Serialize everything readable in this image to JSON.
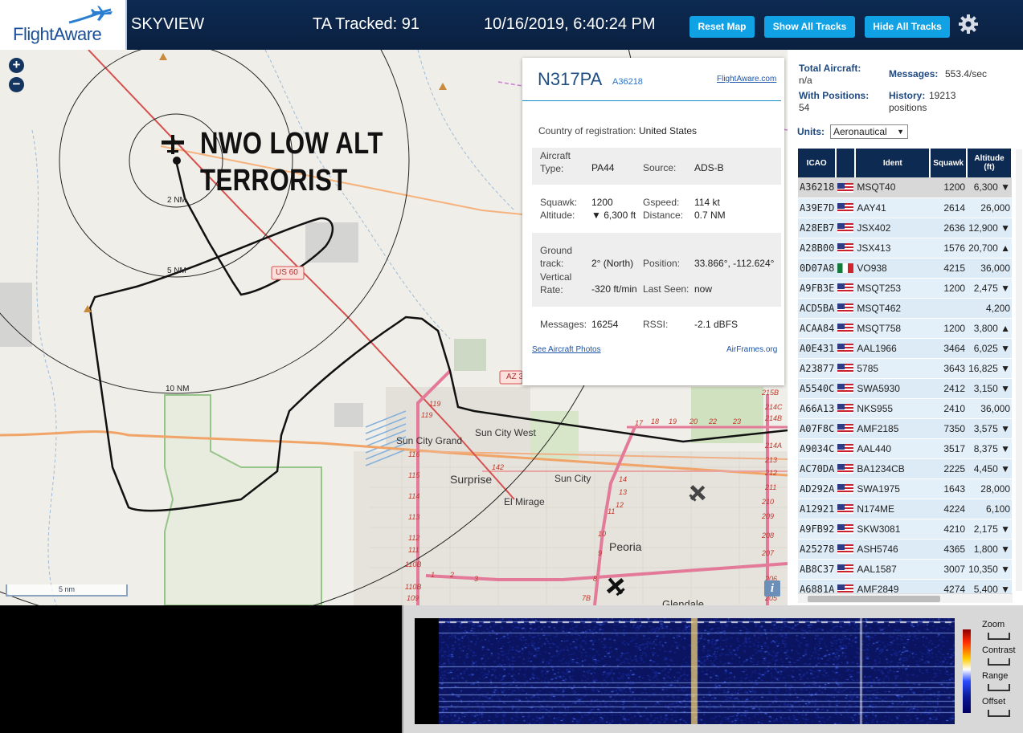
{
  "header": {
    "logo_text": "FlightAware",
    "app_title": "SKYVIEW",
    "tracked": "TA Tracked: 91",
    "datetime": "10/16/2019, 6:40:24 PM",
    "buttons": {
      "reset_map": "Reset Map",
      "show_all": "Show All Tracks",
      "hide_all": "Hide All Tracks"
    },
    "icons": {
      "settings": "gear-icon"
    },
    "colors": {
      "bar": "#0d2a52",
      "button": "#11a2e6"
    }
  },
  "map": {
    "zoom_in": "+",
    "zoom_out": "−",
    "overlay_text": [
      "NWO LOW ALT",
      "TERRORIST"
    ],
    "rings": [
      "2 NM",
      "5 NM",
      "10 NM"
    ],
    "places": [
      "Sun City Grand",
      "Sun City West",
      "Surprise",
      "Sun City",
      "El Mirage",
      "Peoria",
      "Glendale"
    ],
    "highways": [
      "US 60",
      "AZ 3"
    ],
    "exits_left": [
      "119",
      "119",
      "116",
      "115",
      "114",
      "113",
      "112",
      "111",
      "110B",
      "110B",
      "109"
    ],
    "exits_mid": [
      "142",
      "14",
      "13",
      "12",
      "11",
      "10",
      "9",
      "8",
      "7B"
    ],
    "exits_right": [
      "215B",
      "214C",
      "214B",
      "214A",
      "213",
      "212",
      "211",
      "210",
      "209",
      "208",
      "207",
      "206",
      "205"
    ],
    "exits_top": [
      "17",
      "18",
      "19",
      "20",
      "22",
      "23"
    ],
    "exits_bottom": [
      "1",
      "2",
      "3"
    ],
    "scale": "5 nm",
    "info": "i"
  },
  "popup": {
    "registration": "N317PA",
    "hex": "A36218",
    "link": "FlightAware.com",
    "country_label": "Country of registration:",
    "country": "United States",
    "aircraft_type_label": "Aircraft Type:",
    "aircraft_type": "PA44",
    "source_label": "Source:",
    "source": "ADS-B",
    "squawk_label": "Squawk:",
    "squawk": "1200",
    "gspeed_label": "Gspeed:",
    "gspeed": "114 kt",
    "altitude_label": "Altitude:",
    "altitude": "▼ 6,300 ft",
    "distance_label": "Distance:",
    "distance": "0.7 NM",
    "ground_track_label": "Ground track:",
    "ground_track": "2° (North)",
    "position_label": "Position:",
    "position": "33.866°, -112.624°",
    "vrate_label": "Vertical Rate:",
    "vrate": "-320 ft/min",
    "last_seen_label": "Last Seen:",
    "last_seen": "now",
    "messages_label": "Messages:",
    "messages": "16254",
    "rssi_label": "RSSI:",
    "rssi": "-2.1 dBFS",
    "photos": "See Aircraft Photos",
    "airframes": "AirFrames.org"
  },
  "sidebar": {
    "total_label": "Total Aircraft:",
    "total": "n/a",
    "messages_label": "Messages:",
    "messages": "553.4/sec",
    "with_pos_label": "With Positions:",
    "with_pos": "54",
    "history_label": "History:",
    "history": "19213 positions",
    "units_label": "Units:",
    "units": "Aeronautical",
    "columns": [
      "ICAO",
      "",
      "Ident",
      "Squawk",
      "Altitude (ft)"
    ],
    "rows": [
      {
        "icao": "A36218",
        "flag": "us",
        "ident": "MSQT40",
        "squawk": "1200",
        "alt": "6,300 ▼"
      },
      {
        "icao": "A39E7D",
        "flag": "us",
        "ident": "AAY41",
        "squawk": "2614",
        "alt": "26,000"
      },
      {
        "icao": "A28EB7",
        "flag": "us",
        "ident": "JSX402",
        "squawk": "2636",
        "alt": "12,900 ▼"
      },
      {
        "icao": "A28B00",
        "flag": "us",
        "ident": "JSX413",
        "squawk": "1576",
        "alt": "20,700 ▲"
      },
      {
        "icao": "0D07A8",
        "flag": "mx",
        "ident": "VO938",
        "squawk": "4215",
        "alt": "36,000"
      },
      {
        "icao": "A9FB3E",
        "flag": "us",
        "ident": "MSQT253",
        "squawk": "1200",
        "alt": "2,475 ▼"
      },
      {
        "icao": "ACD5BA",
        "flag": "us",
        "ident": "MSQT462",
        "squawk": "",
        "alt": "4,200"
      },
      {
        "icao": "ACAA84",
        "flag": "us",
        "ident": "MSQT758",
        "squawk": "1200",
        "alt": "3,800 ▲"
      },
      {
        "icao": "A0E431",
        "flag": "us",
        "ident": "AAL1966",
        "squawk": "3464",
        "alt": "6,025 ▼"
      },
      {
        "icao": "A23877",
        "flag": "us",
        "ident": "5785",
        "squawk": "3643",
        "alt": "16,825 ▼"
      },
      {
        "icao": "A5540C",
        "flag": "us",
        "ident": "SWA5930",
        "squawk": "2412",
        "alt": "3,150 ▼"
      },
      {
        "icao": "A66A13",
        "flag": "us",
        "ident": "NKS955",
        "squawk": "2410",
        "alt": "36,000"
      },
      {
        "icao": "A07F8C",
        "flag": "us",
        "ident": "AMF2185",
        "squawk": "7350",
        "alt": "3,575 ▼"
      },
      {
        "icao": "A9034C",
        "flag": "us",
        "ident": "AAL440",
        "squawk": "3517",
        "alt": "8,375 ▼"
      },
      {
        "icao": "AC70DA",
        "flag": "us",
        "ident": "BA1234CB",
        "squawk": "2225",
        "alt": "4,450 ▼"
      },
      {
        "icao": "AD292A",
        "flag": "us",
        "ident": "SWA1975",
        "squawk": "1643",
        "alt": "28,000"
      },
      {
        "icao": "A12921",
        "flag": "us",
        "ident": "N174ME",
        "squawk": "4224",
        "alt": "6,100"
      },
      {
        "icao": "A9FB92",
        "flag": "us",
        "ident": "SKW3081",
        "squawk": "4210",
        "alt": "2,175 ▼"
      },
      {
        "icao": "A25278",
        "flag": "us",
        "ident": "ASH5746",
        "squawk": "4365",
        "alt": "1,800 ▼"
      },
      {
        "icao": "AB8C37",
        "flag": "us",
        "ident": "AAL1587",
        "squawk": "3007",
        "alt": "10,350 ▼"
      },
      {
        "icao": "A6881A",
        "flag": "us",
        "ident": "AMF2849",
        "squawk": "4274",
        "alt": "5,400 ▼"
      }
    ]
  },
  "waterfall": {
    "labels": [
      "Zoom",
      "Contrast",
      "Range",
      "Offset"
    ]
  }
}
